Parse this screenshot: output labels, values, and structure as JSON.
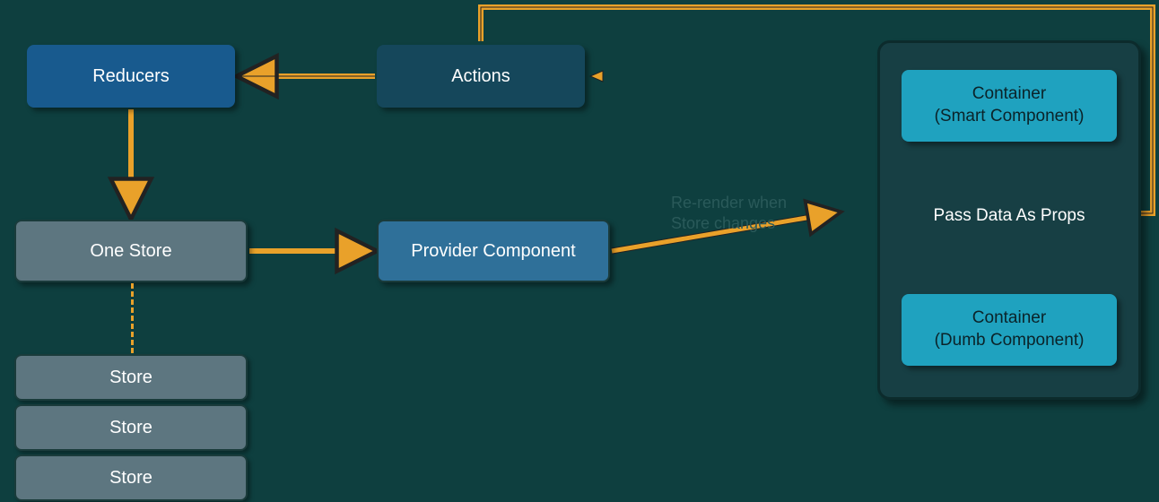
{
  "nodes": {
    "reducers": "Reducers",
    "actions": "Actions",
    "one_store": "One Store",
    "provider": "Provider Component",
    "smart": "Container\n(Smart Component)",
    "dumb": "Container\n(Dumb Component)",
    "pass_props": "Pass Data As Props"
  },
  "store_stack": [
    "Store",
    "Store",
    "Store"
  ],
  "edge_label": "Re-render when\nStore changes",
  "colors": {
    "page_bg": "#0e3f3f",
    "arrow": "#e9a12a",
    "arrow_border": "#222",
    "reducers_bg": "#185a8e",
    "actions_bg": "#15475b",
    "store_bg": "#5d7680",
    "provider_bg": "#2f7099",
    "panel_bg": "#173f44",
    "container_bg": "#1fa2bf"
  }
}
